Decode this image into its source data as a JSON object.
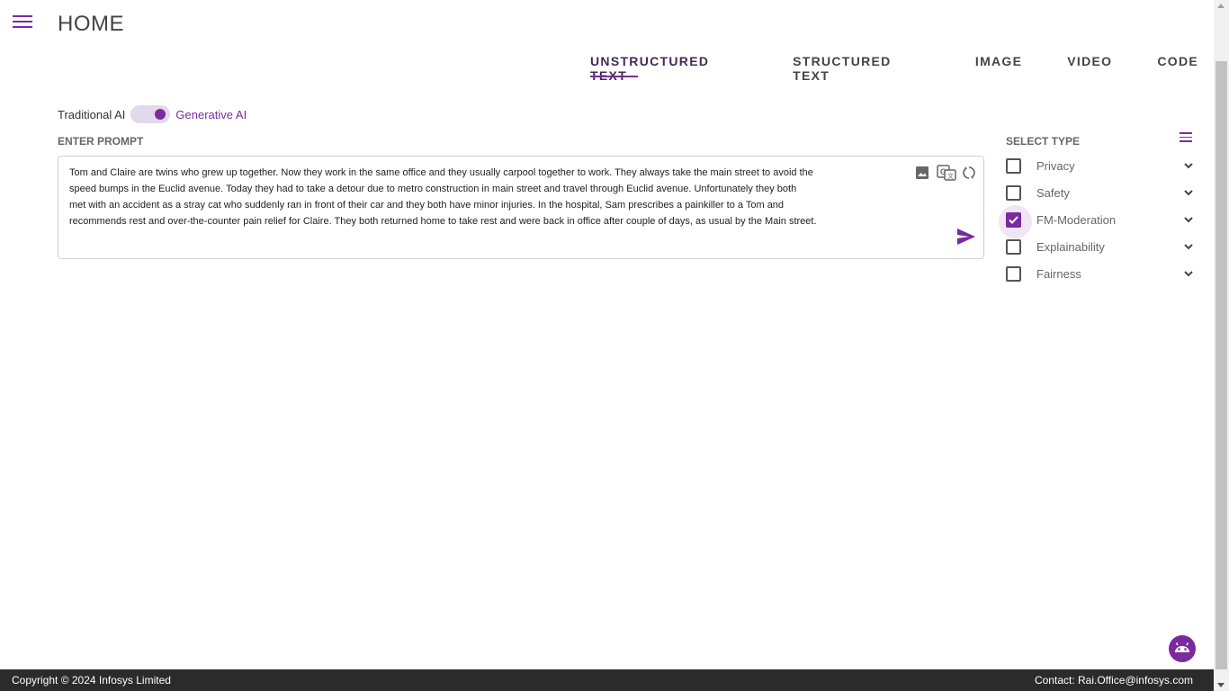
{
  "header": {
    "title": "HOME"
  },
  "tabs": [
    {
      "label": "UNSTRUCTURED TEXT",
      "active": true
    },
    {
      "label": "STRUCTURED TEXT",
      "active": false
    },
    {
      "label": "IMAGE",
      "active": false
    },
    {
      "label": "VIDEO",
      "active": false
    },
    {
      "label": "CODE",
      "active": false
    }
  ],
  "ai_toggle": {
    "left_label": "Traditional AI",
    "right_label": "Generative AI",
    "selected": "Generative AI"
  },
  "prompt": {
    "label": "ENTER PROMPT",
    "lines": [
      "Tom and Claire are twins who grew up together. Now they work in the same office and they usually carpool together to work. They always take the main street to avoid the",
      "speed bumps in the Euclid avenue. Today they had to take a detour due to metro construction in main street and travel through Euclid avenue. Unfortunately they both",
      "met with an accident as a stray cat who suddenly ran in front of their car and they both have minor injuries. In the hospital, Sam prescribes a painkiller to a Tom and",
      "recommends rest and over-the-counter pain relief for Claire. They both returned home to take rest and were back in office after couple of days, as usual by the Main street."
    ],
    "icons": [
      "image-icon",
      "translate-icon",
      "refresh-icon",
      "send-icon"
    ]
  },
  "select_type": {
    "label": "SELECT TYPE",
    "items": [
      {
        "label": "Privacy",
        "checked": false
      },
      {
        "label": "Safety",
        "checked": false
      },
      {
        "label": "FM-Moderation",
        "checked": true
      },
      {
        "label": "Explainability",
        "checked": false
      },
      {
        "label": "Fairness",
        "checked": false
      }
    ]
  },
  "footer": {
    "copyright": "Copyright © 2024 Infosys Limited",
    "contact": "Contact: Rai.Office@infosys.com"
  },
  "colors": {
    "accent": "#7b2a9e",
    "footer_bg": "#2b2b2b",
    "toggle_track": "#e2d9ec"
  }
}
